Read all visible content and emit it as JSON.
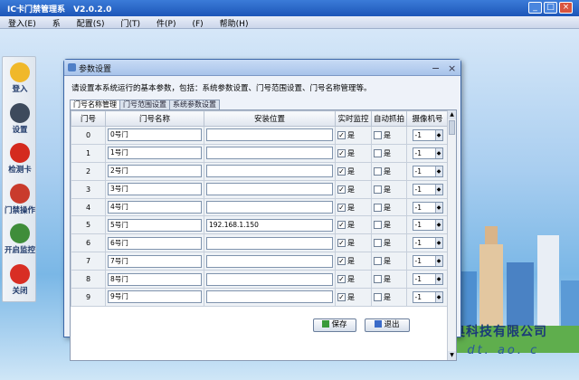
{
  "app": {
    "title": "IC卡门禁管理系",
    "version": "V2.0.2.0"
  },
  "menu": [
    "登入(E)",
    "系",
    "配置(S)",
    "门(T)",
    "件(P)",
    "(F)",
    "帮助(H)"
  ],
  "sidebar": [
    {
      "label": "登入",
      "icon": "key-icon",
      "color": "#f0b82a"
    },
    {
      "label": "设置",
      "icon": "gear-icon",
      "color": "#3d4a5c"
    },
    {
      "label": "检测卡",
      "icon": "card-icon",
      "color": "#d42a1e"
    },
    {
      "label": "门禁操作",
      "icon": "door-icon",
      "color": "#c93b2c"
    },
    {
      "label": "开启监控",
      "icon": "camera-icon",
      "color": "#3f8d3a"
    },
    {
      "label": "关闭",
      "icon": "power-icon",
      "color": "#d82e24"
    }
  ],
  "dialog": {
    "title": "参数设置",
    "description": "请设置本系统运行的基本参数，包括：系统参数设置、门号范围设置、门号名称管理等。",
    "tabs": [
      "门号名称管理",
      "门号范围设置",
      "系统参数设置"
    ],
    "columns": [
      "门号",
      "门号名称",
      "安装位置",
      "实时监控",
      "自动抓拍",
      "摄像机号"
    ],
    "rows": [
      {
        "num": "0",
        "name": "0号门",
        "loc": "",
        "monitor": "是",
        "capture": "是",
        "cam": "-1"
      },
      {
        "num": "1",
        "name": "1号门",
        "loc": "",
        "monitor": "是",
        "capture": "是",
        "cam": "-1"
      },
      {
        "num": "2",
        "name": "2号门",
        "loc": "",
        "monitor": "是",
        "capture": "是",
        "cam": "-1"
      },
      {
        "num": "3",
        "name": "3号门",
        "loc": "",
        "monitor": "是",
        "capture": "是",
        "cam": "-1"
      },
      {
        "num": "4",
        "name": "4号门",
        "loc": "",
        "monitor": "是",
        "capture": "是",
        "cam": "-1"
      },
      {
        "num": "5",
        "name": "5号门",
        "loc": "192.168.1.150",
        "monitor": "是",
        "capture": "是",
        "cam": "-1"
      },
      {
        "num": "6",
        "name": "6号门",
        "loc": "",
        "monitor": "是",
        "capture": "是",
        "cam": "-1"
      },
      {
        "num": "7",
        "name": "7号门",
        "loc": "",
        "monitor": "是",
        "capture": "是",
        "cam": "-1"
      },
      {
        "num": "8",
        "name": "8号门",
        "loc": "",
        "monitor": "是",
        "capture": "是",
        "cam": "-1"
      },
      {
        "num": "9",
        "name": "9号门",
        "loc": "",
        "monitor": "是",
        "capture": "是",
        "cam": "-1"
      }
    ],
    "save": "保存",
    "exit": "退出"
  },
  "company": "奥科技有限公司",
  "website": "www. dt. ao. c"
}
